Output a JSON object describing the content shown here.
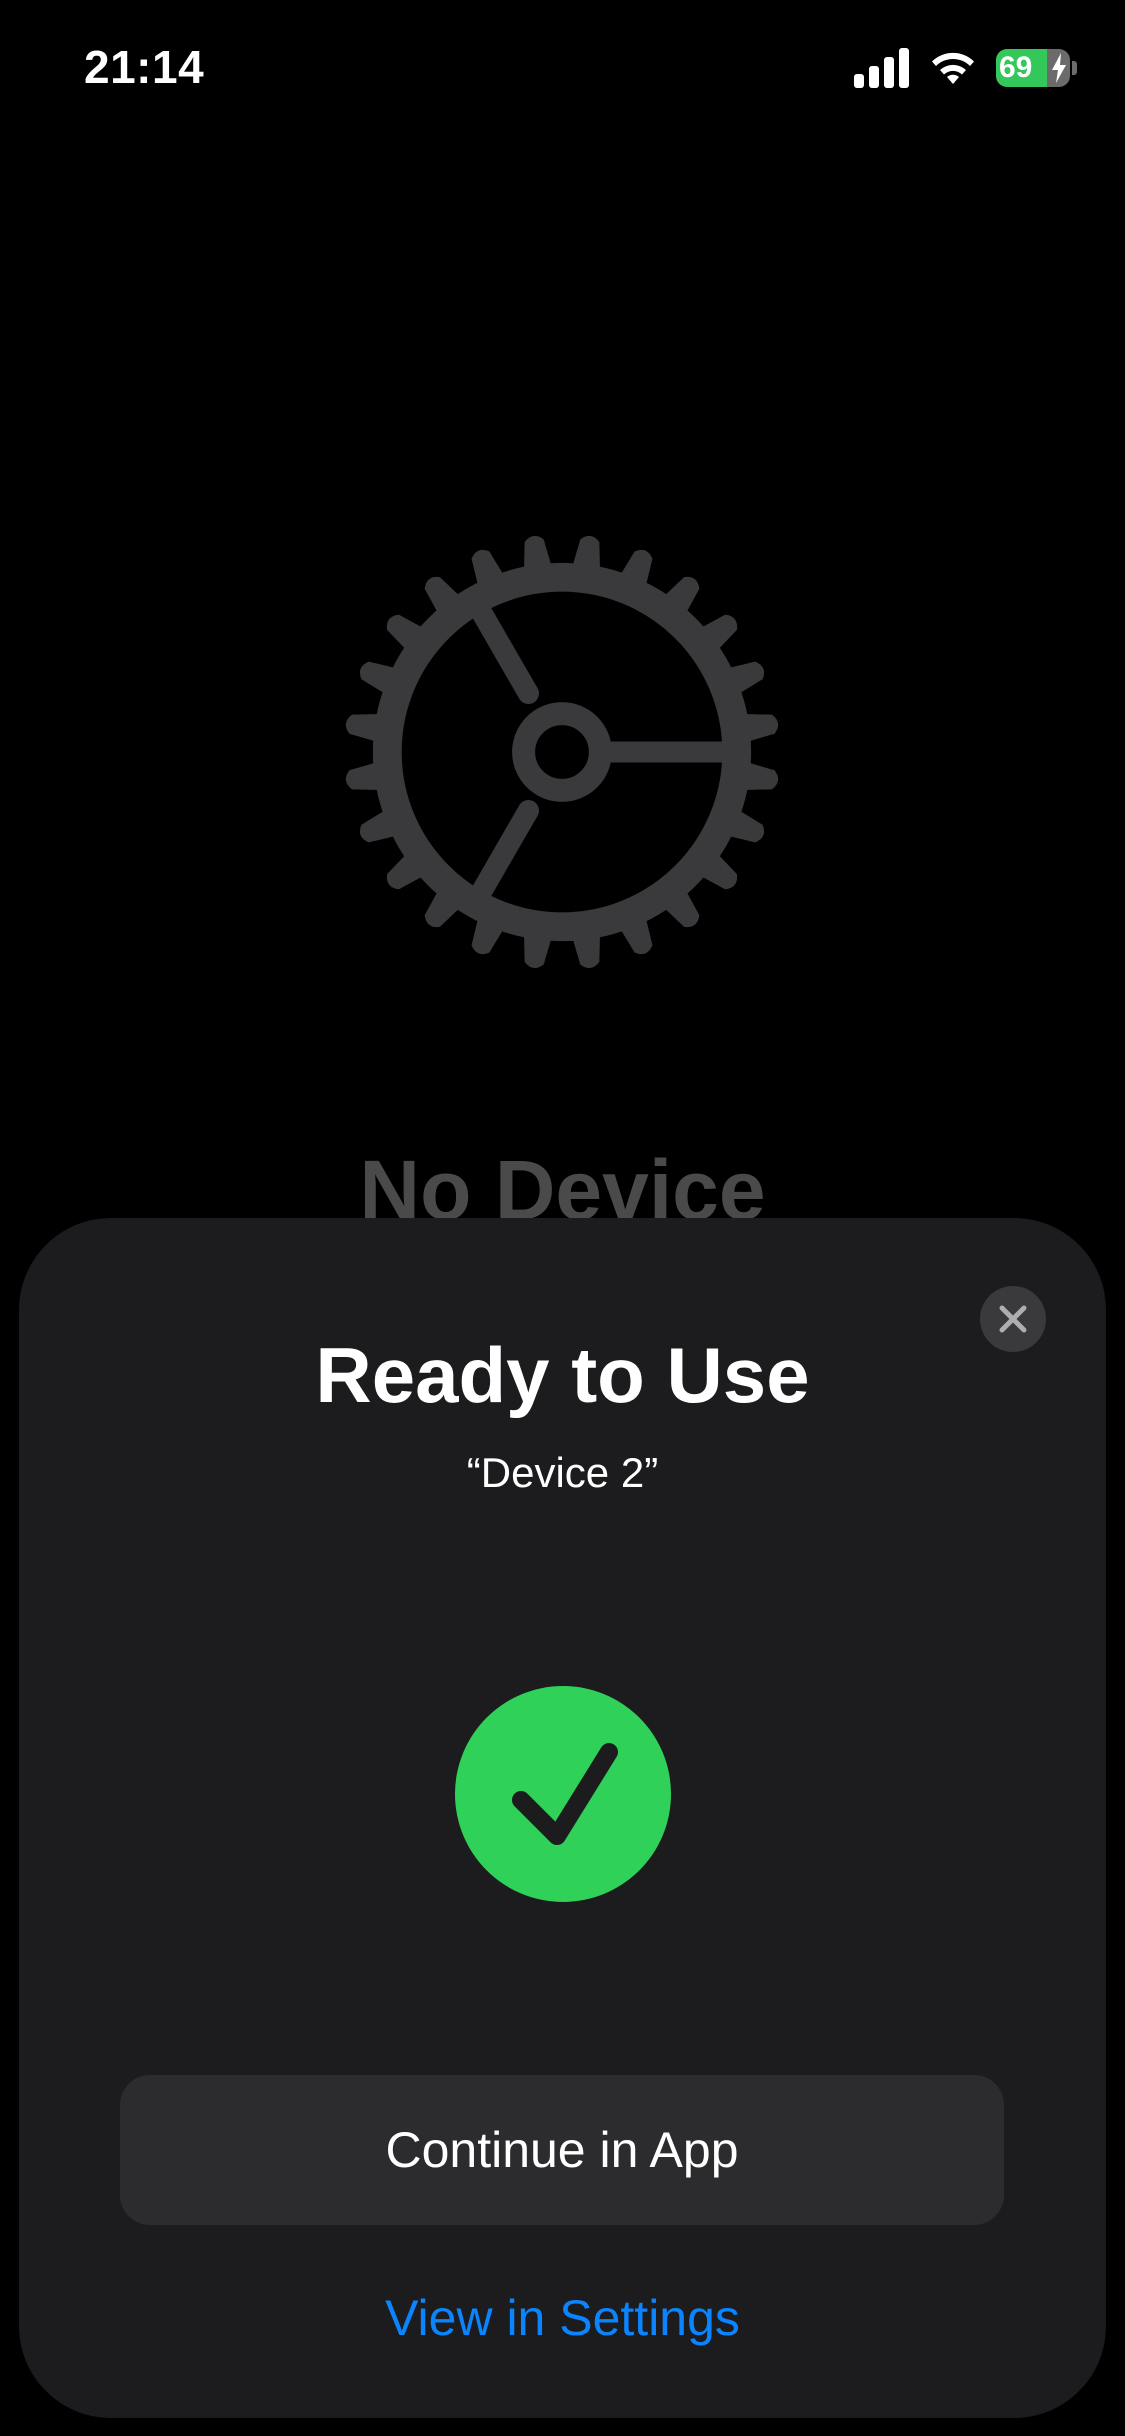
{
  "status_bar": {
    "time": "21:14",
    "battery_level": "69",
    "battery_percent": 69,
    "battery_charging": true,
    "signal_icon": "cellular-signal-icon",
    "wifi_icon": "wifi-icon"
  },
  "background": {
    "icon": "settings-gear-icon",
    "title": "No Device"
  },
  "sheet": {
    "title": "Ready to Use",
    "device_name": "“Device 2”",
    "close_icon": "close-icon",
    "status_icon": "checkmark-circle-icon",
    "primary_button_label": "Continue in App",
    "secondary_link_label": "View in Settings"
  },
  "colors": {
    "background": "#000000",
    "sheet": "#1c1c1e",
    "success": "#30d158",
    "link": "#0a84ff",
    "button": "#2c2c2e"
  }
}
